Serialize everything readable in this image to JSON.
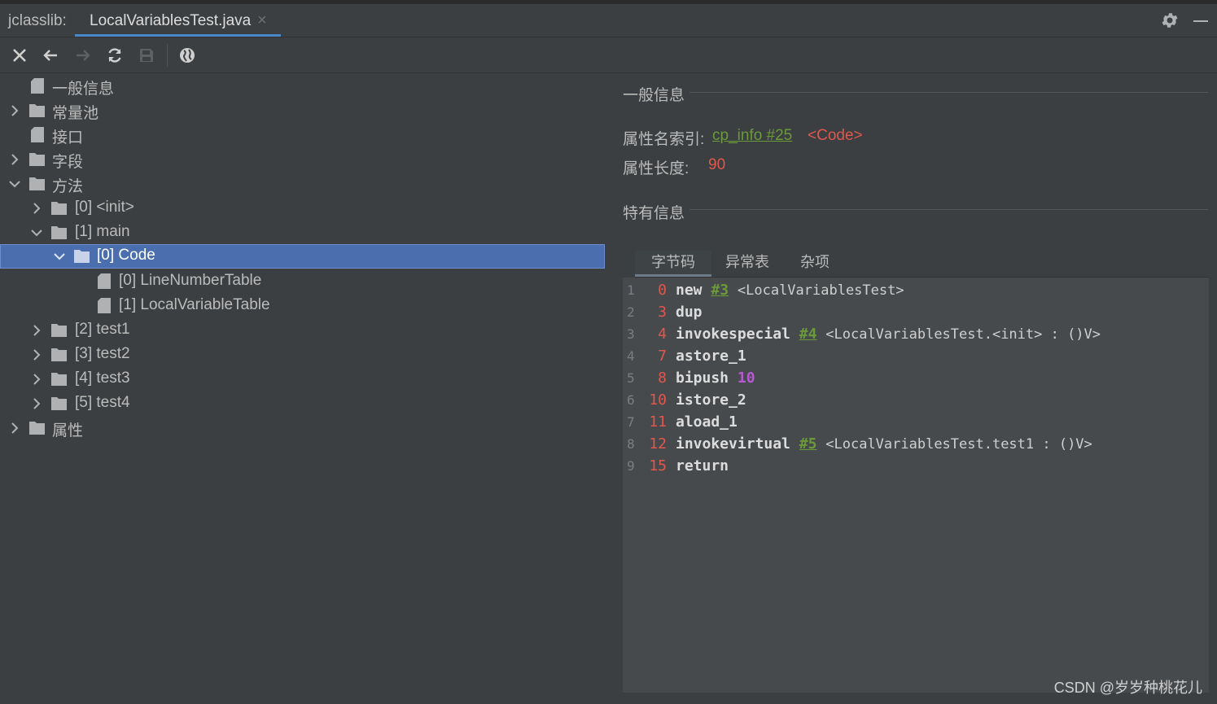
{
  "titlebar": {
    "app_label": "jclasslib:",
    "tab_label": "LocalVariablesTest.java",
    "tab_close": "×",
    "gear_icon": "gear-icon",
    "minimize_icon": "minimize-icon"
  },
  "toolbar": {
    "buttons": [
      "close-icon",
      "back-arrow-icon",
      "forward-arrow-icon",
      "refresh-icon",
      "save-icon",
      "globe-icon"
    ]
  },
  "tree": {
    "items": [
      {
        "label": "一般信息"
      },
      {
        "label": "常量池"
      },
      {
        "label": "接口"
      },
      {
        "label": "字段"
      },
      {
        "label": "方法"
      },
      {
        "label": "[0] <init>"
      },
      {
        "label": "[1] main"
      },
      {
        "label": "[0] Code"
      },
      {
        "label": "[0] LineNumberTable"
      },
      {
        "label": "[1] LocalVariableTable"
      },
      {
        "label": "[2] test1"
      },
      {
        "label": "[3] test2"
      },
      {
        "label": "[4] test3"
      },
      {
        "label": "[5] test4"
      },
      {
        "label": "属性"
      }
    ]
  },
  "detail": {
    "general_title": "一般信息",
    "attr_name_key": "属性名索引:",
    "attr_name_link": "cp_info #25",
    "attr_name_value": "<Code>",
    "attr_len_key": "属性长度:",
    "attr_len_value": "90",
    "specific_title": "特有信息",
    "tabs": [
      "字节码",
      "异常表",
      "杂项"
    ]
  },
  "bytecode": [
    {
      "line": "1",
      "offset": "0",
      "op": "new",
      "ref": "#3",
      "num": "",
      "comment": "<LocalVariablesTest>"
    },
    {
      "line": "2",
      "offset": "3",
      "op": "dup",
      "ref": "",
      "num": "",
      "comment": ""
    },
    {
      "line": "3",
      "offset": "4",
      "op": "invokespecial",
      "ref": "#4",
      "num": "",
      "comment": "<LocalVariablesTest.<init> : ()V>"
    },
    {
      "line": "4",
      "offset": "7",
      "op": "astore_1",
      "ref": "",
      "num": "",
      "comment": ""
    },
    {
      "line": "5",
      "offset": "8",
      "op": "bipush",
      "ref": "",
      "num": "10",
      "comment": ""
    },
    {
      "line": "6",
      "offset": "10",
      "op": "istore_2",
      "ref": "",
      "num": "",
      "comment": ""
    },
    {
      "line": "7",
      "offset": "11",
      "op": "aload_1",
      "ref": "",
      "num": "",
      "comment": ""
    },
    {
      "line": "8",
      "offset": "12",
      "op": "invokevirtual",
      "ref": "#5",
      "num": "",
      "comment": "<LocalVariablesTest.test1 : ()V>"
    },
    {
      "line": "9",
      "offset": "15",
      "op": "return",
      "ref": "",
      "num": "",
      "comment": ""
    }
  ],
  "watermark": "CSDN @岁岁种桃花儿",
  "colors": {
    "selection": "#4b6eaf",
    "link_green": "#6a9a3a",
    "red": "#e0574d",
    "purple": "#b65ad1"
  }
}
